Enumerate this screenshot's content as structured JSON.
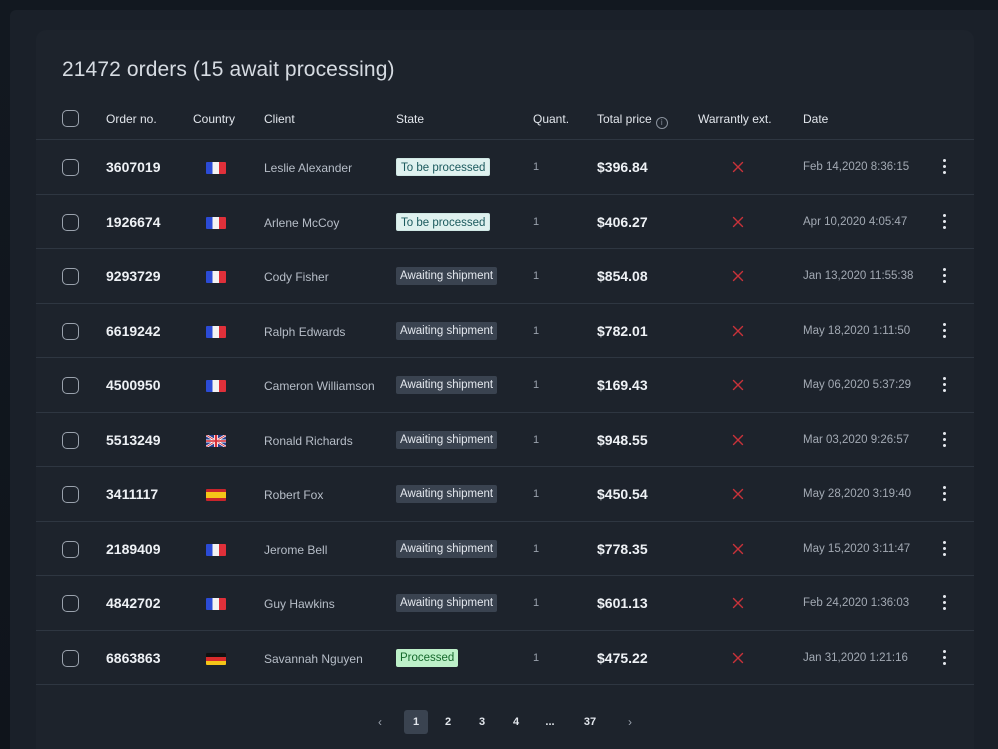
{
  "header": {
    "title": "21472 orders (15 await processing)"
  },
  "columns": {
    "order_no": "Order no.",
    "country": "Country",
    "client": "Client",
    "state": "State",
    "quant": "Quant.",
    "total_price": "Total price",
    "warranty": "Warrantly ext.",
    "date": "Date"
  },
  "icons": {
    "info": "info-icon",
    "warranty_no": "x-icon",
    "menu": "kebab-icon"
  },
  "colors": {
    "x_mark": "#c8323a",
    "to_be_processed_bg": "#dff1ef",
    "awaiting_bg": "#3a4350",
    "processed_bg": "#bdf0c9"
  },
  "rows": [
    {
      "order_no": "3607019",
      "flag": "fr",
      "client": "Leslie Alexander",
      "state": "To be processed",
      "state_kind": "tbp",
      "quant": "1",
      "price": "$396.84",
      "date": "Feb 14,2020 8:36:15"
    },
    {
      "order_no": "1926674",
      "flag": "fr",
      "client": "Arlene McCoy",
      "state": "To be processed",
      "state_kind": "tbp",
      "quant": "1",
      "price": "$406.27",
      "date": "Apr 10,2020 4:05:47"
    },
    {
      "order_no": "9293729",
      "flag": "fr",
      "client": "Cody Fisher",
      "state": "Awaiting shipment",
      "state_kind": "await",
      "quant": "1",
      "price": "$854.08",
      "date": "Jan 13,2020 11:55:38"
    },
    {
      "order_no": "6619242",
      "flag": "fr",
      "client": "Ralph Edwards",
      "state": "Awaiting shipment",
      "state_kind": "await",
      "quant": "1",
      "price": "$782.01",
      "date": "May 18,2020 1:11:50"
    },
    {
      "order_no": "4500950",
      "flag": "fr",
      "client": "Cameron Williamson",
      "state": "Awaiting shipment",
      "state_kind": "await",
      "quant": "1",
      "price": "$169.43",
      "date": "May 06,2020 5:37:29"
    },
    {
      "order_no": "5513249",
      "flag": "gb",
      "client": "Ronald Richards",
      "state": "Awaiting shipment",
      "state_kind": "await",
      "quant": "1",
      "price": "$948.55",
      "date": "Mar 03,2020 9:26:57"
    },
    {
      "order_no": "3411117",
      "flag": "es",
      "client": "Robert Fox",
      "state": "Awaiting shipment",
      "state_kind": "await",
      "quant": "1",
      "price": "$450.54",
      "date": "May 28,2020 3:19:40"
    },
    {
      "order_no": "2189409",
      "flag": "fr",
      "client": "Jerome Bell",
      "state": "Awaiting shipment",
      "state_kind": "await",
      "quant": "1",
      "price": "$778.35",
      "date": "May 15,2020 3:11:47"
    },
    {
      "order_no": "4842702",
      "flag": "fr",
      "client": "Guy Hawkins",
      "state": "Awaiting shipment",
      "state_kind": "await",
      "quant": "1",
      "price": "$601.13",
      "date": "Feb 24,2020 1:36:03"
    },
    {
      "order_no": "6863863",
      "flag": "de",
      "client": "Savannah Nguyen",
      "state": "Processed",
      "state_kind": "proc",
      "quant": "1",
      "price": "$475.22",
      "date": "Jan 31,2020 1:21:16"
    }
  ],
  "pagination": {
    "prev": "‹",
    "pages": [
      "1",
      "2",
      "3",
      "4",
      "...",
      "37"
    ],
    "active": "1",
    "next": "›"
  }
}
